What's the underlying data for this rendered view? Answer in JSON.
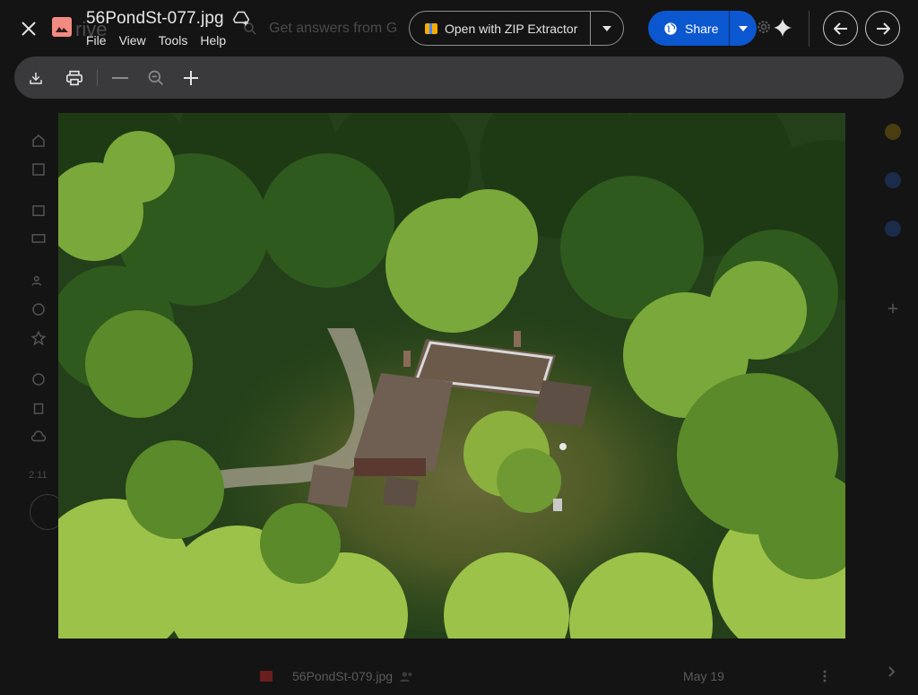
{
  "file": {
    "name": "56PondSt-077.jpg"
  },
  "menu": [
    {
      "label": "File"
    },
    {
      "label": "View"
    },
    {
      "label": "Tools"
    },
    {
      "label": "Help"
    }
  ],
  "open_with": {
    "label": "Open with ZIP Extractor"
  },
  "share": {
    "label": "Share",
    "color": "#0b57d0"
  },
  "background": {
    "app_logo_text": "rive",
    "search_placeholder": "Get answers from G",
    "storage_text": "2.11",
    "file_row": {
      "name": "56PondSt-079.jpg",
      "date": "May 19"
    }
  },
  "icons": {
    "close": "close-icon",
    "file_type": "image-file-icon",
    "add_to_drive": "add-to-drive-icon",
    "open_with_dropdown": "chevron-down-icon",
    "share": "globe-icon",
    "share_dropdown": "chevron-down-icon",
    "gemini": "sparkle-icon",
    "previous": "arrow-left-icon",
    "next": "arrow-right-icon",
    "download": "download-icon",
    "print": "print-icon",
    "zoom_out": "minus-icon",
    "zoom_fit": "magnifier-icon",
    "zoom_in": "plus-icon"
  },
  "colors": {
    "viewer_bg": "#141414",
    "toolbar_bg": "#3a3a3c",
    "accent": "#0b57d0"
  }
}
